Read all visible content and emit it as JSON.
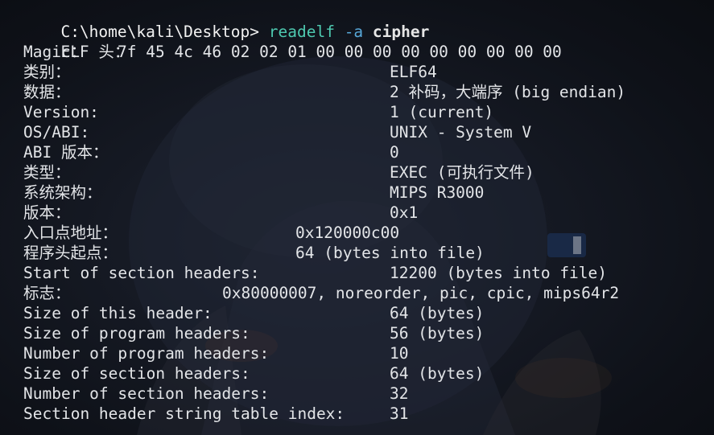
{
  "prompt": {
    "path": "C:\\home\\kali\\Desktop>",
    "command": "readelf",
    "option": "-a",
    "argument": "cipher"
  },
  "header_title": "ELF 头：",
  "magic": {
    "label": "Magic：",
    "bytes": "7f 45 4c 46 02 02 01 00 00 00 00 00 00 00 00 00"
  },
  "rows": [
    {
      "label": "类别：",
      "value": "ELF64"
    },
    {
      "label": "数据：",
      "value": "2 补码，大端序 (big endian)"
    },
    {
      "label": "Version:",
      "value": "1 (current)"
    },
    {
      "label": "OS/ABI:",
      "value": "UNIX - System V"
    },
    {
      "label": "ABI 版本：",
      "value": "0"
    },
    {
      "label": "类型：",
      "value": "EXEC (可执行文件)"
    },
    {
      "label": "系统架构：",
      "value": "MIPS R3000"
    },
    {
      "label": "版本：",
      "value": "0x1"
    },
    {
      "label": "入口点地址：",
      "value": "0x120000c00"
    },
    {
      "label": "程序头起点：",
      "value": "64 (bytes into file)"
    },
    {
      "label": "Start of section headers:",
      "value": "12200 (bytes into file)"
    },
    {
      "label": "标志：",
      "value": "0x80000007, noreorder, pic, cpic, mips64r2"
    },
    {
      "label": "Size of this header:",
      "value": "64 (bytes)"
    },
    {
      "label": "Size of program headers:",
      "value": "56 (bytes)"
    },
    {
      "label": "Number of program headers:",
      "value": "10"
    },
    {
      "label": "Size of section headers:",
      "value": "64 (bytes)"
    },
    {
      "label": "Number of section headers:",
      "value": "32"
    },
    {
      "label": "Section header string table index:",
      "value": "31"
    }
  ]
}
